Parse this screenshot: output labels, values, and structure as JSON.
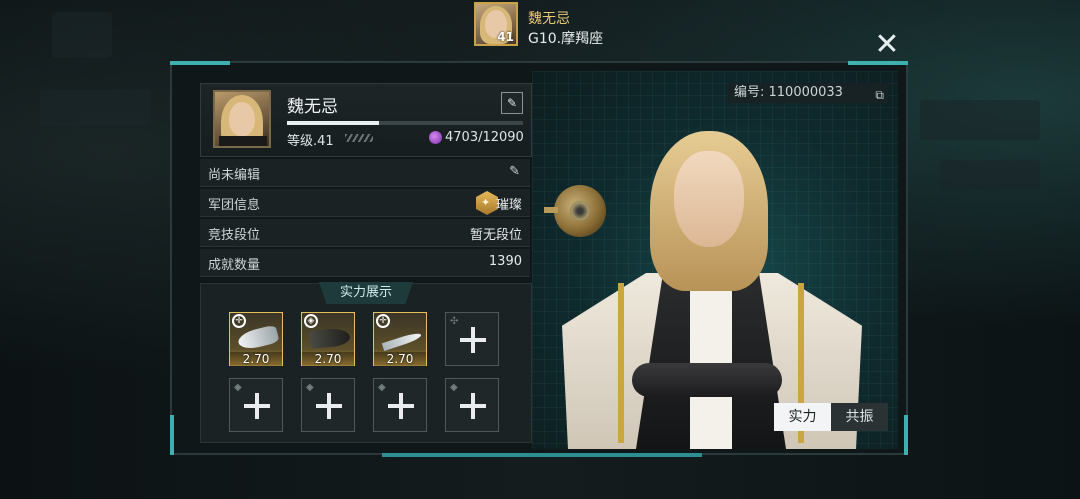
{
  "header": {
    "player_name": "魏无忌",
    "player_level": "41",
    "server": "G10.摩羯座"
  },
  "close_icon": "close-x-icon",
  "profile": {
    "name": "魏无忌",
    "level_label": "等级.41",
    "xp_progress": 0.39,
    "power_value": "4703/12090",
    "signature": "尚未编辑"
  },
  "info_rows": [
    {
      "label": "军团信息",
      "value": "璀璨"
    },
    {
      "label": "竞技段位",
      "value": "暂无段位"
    },
    {
      "label": "成就数量",
      "value": "1390"
    }
  ],
  "showcase": {
    "title": "实力展示",
    "slots": [
      {
        "filled": true,
        "score": "2.70"
      },
      {
        "filled": true,
        "score": "2.70"
      },
      {
        "filled": true,
        "score": "2.70"
      },
      {
        "filled": false
      },
      {
        "filled": false
      },
      {
        "filled": false
      },
      {
        "filled": false
      },
      {
        "filled": false
      }
    ]
  },
  "serial": "编号: 110000033",
  "tabs": {
    "strength": "实力",
    "resonance": "共振"
  },
  "colors": {
    "accent_teal": "#3fb0b0",
    "gold": "#e6c05a",
    "name_gold": "#e8c870"
  }
}
